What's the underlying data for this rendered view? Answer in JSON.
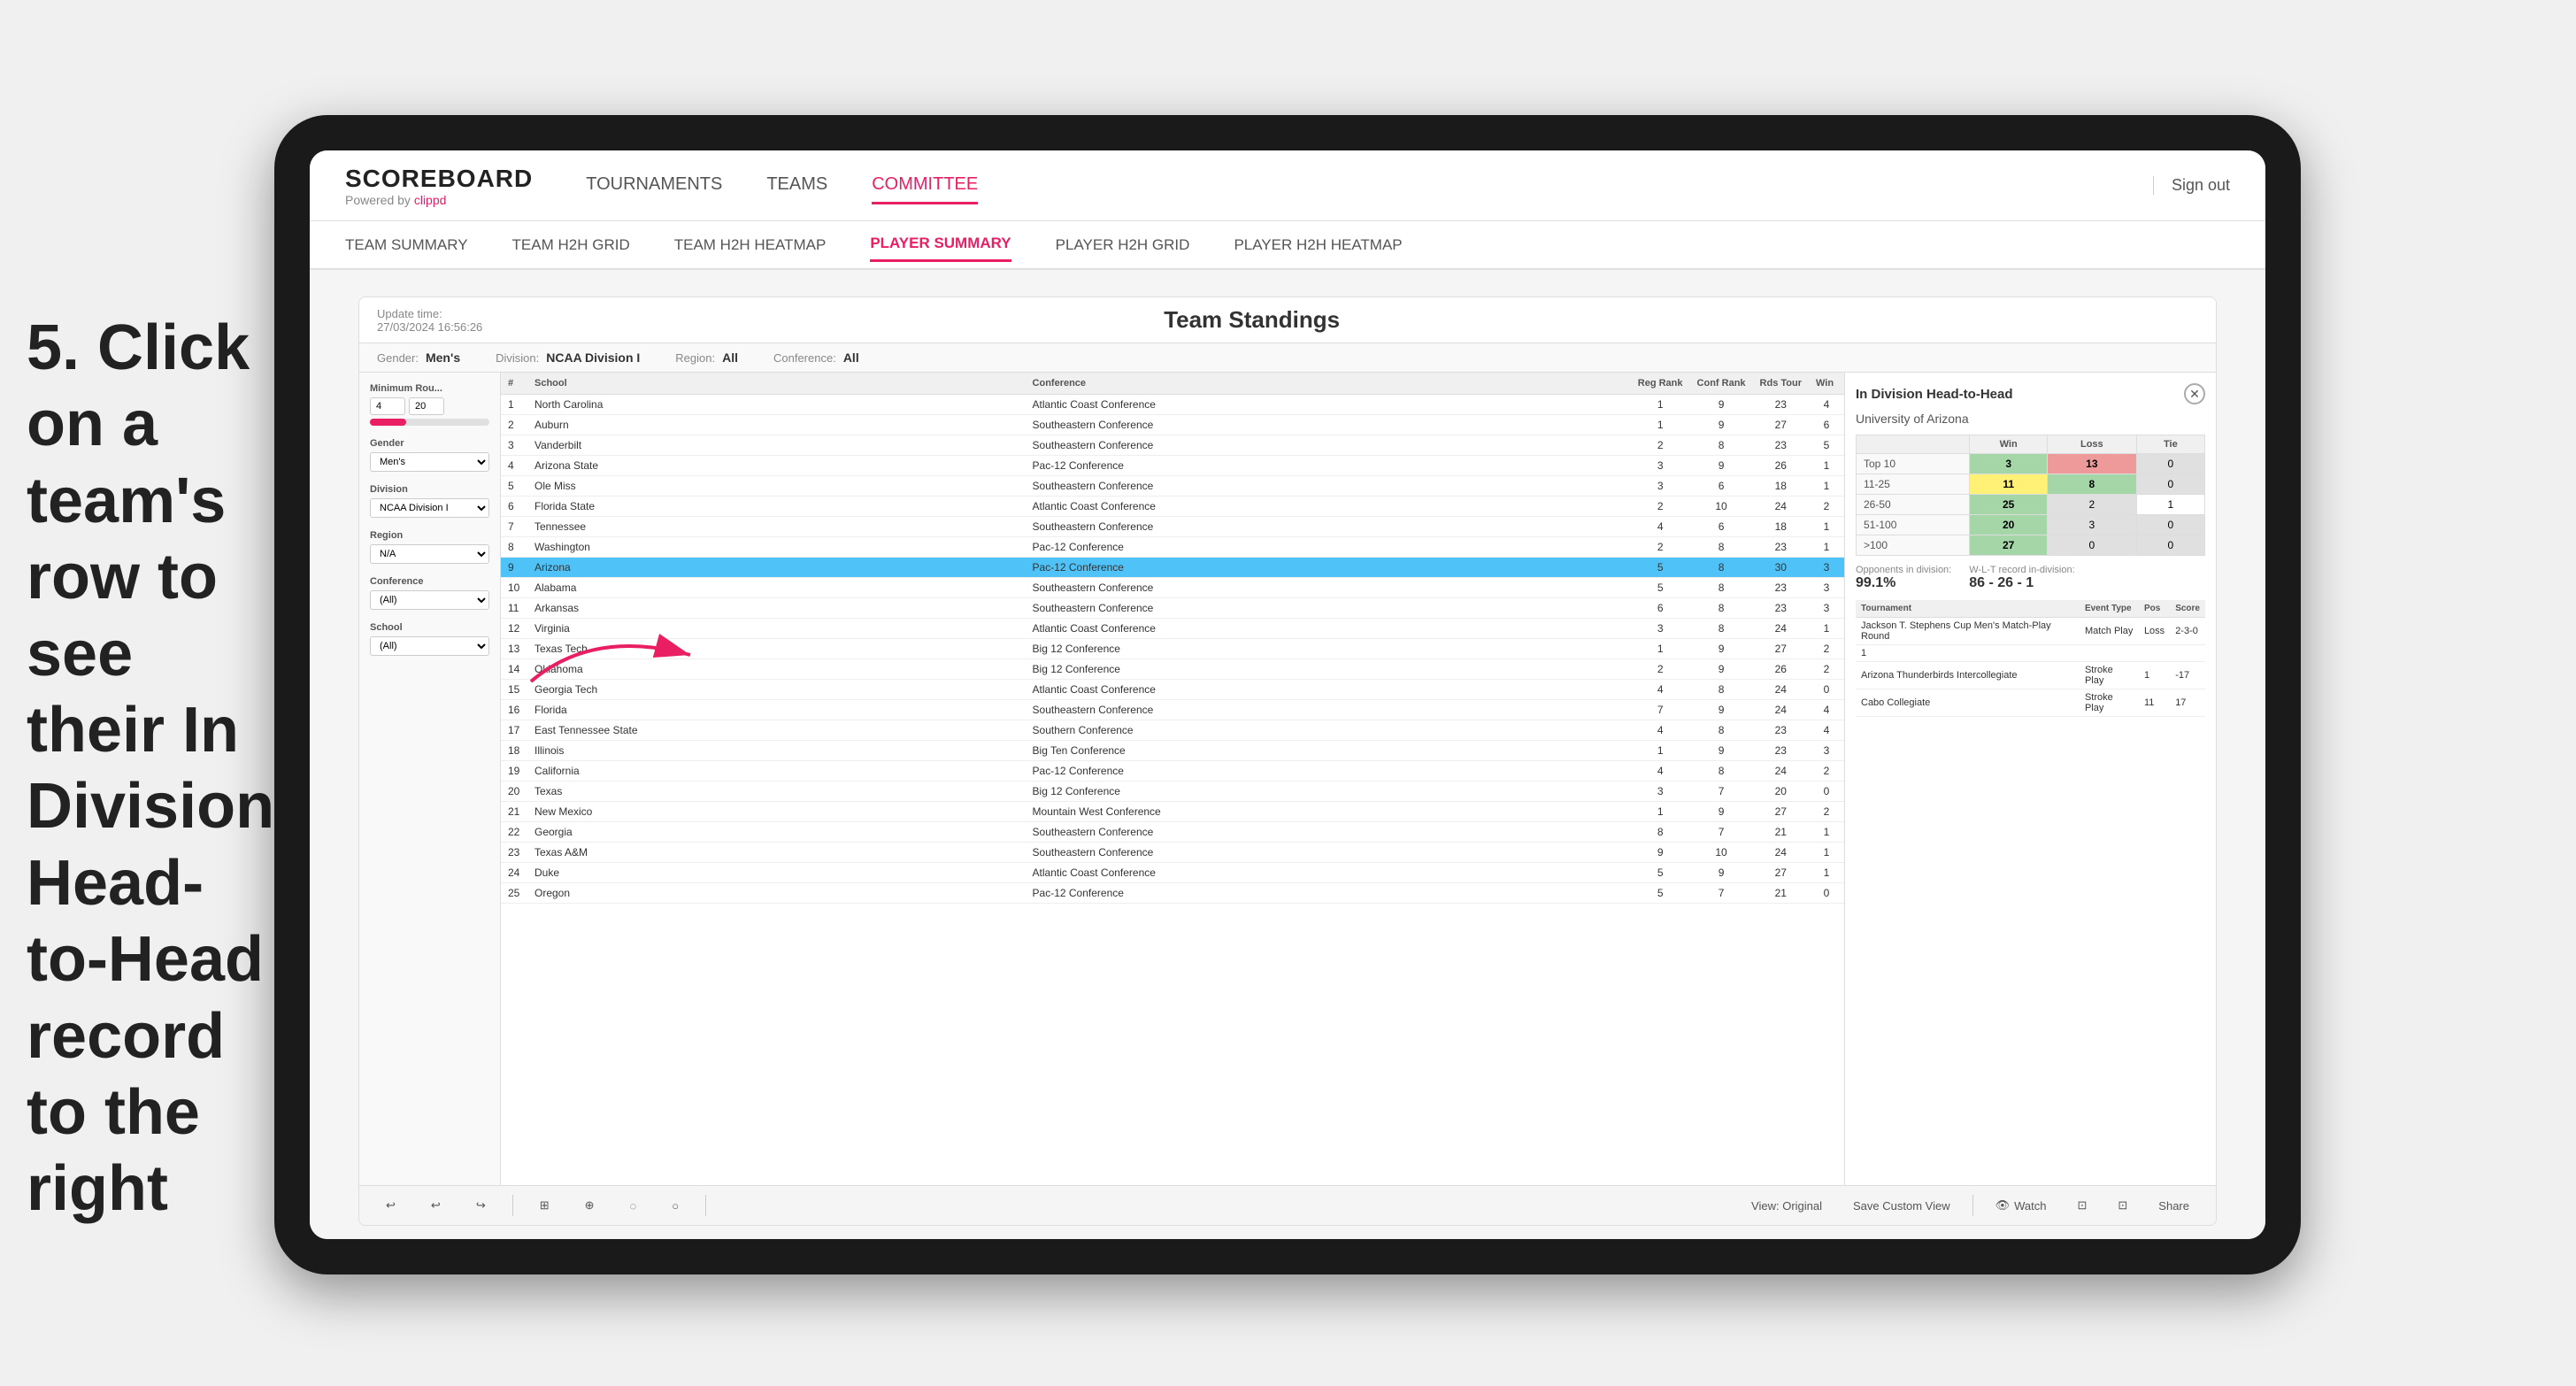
{
  "annotation": {
    "text": "5. Click on a team's row to see their In Division Head-to-Head record to the right"
  },
  "header": {
    "logo": "SCOREBOARD",
    "logo_sub": "Powered by clippd",
    "nav_items": [
      "TOURNAMENTS",
      "TEAMS",
      "COMMITTEE"
    ],
    "active_nav": "COMMITTEE",
    "sign_out": "Sign out"
  },
  "sub_nav": {
    "items": [
      "TEAM SUMMARY",
      "TEAM H2H GRID",
      "TEAM H2H HEATMAP",
      "PLAYER SUMMARY",
      "PLAYER H2H GRID",
      "PLAYER H2H HEATMAP"
    ],
    "active": "PLAYER SUMMARY"
  },
  "app": {
    "update_time_label": "Update time:",
    "update_time": "27/03/2024 16:56:26",
    "title": "Team Standings",
    "filters": {
      "gender_label": "Gender:",
      "gender_value": "Men's",
      "division_label": "Division:",
      "division_value": "NCAA Division I",
      "region_label": "Region:",
      "region_value": "All",
      "conference_label": "Conference:",
      "conference_value": "All"
    },
    "sidebar": {
      "min_rounds_label": "Minimum Rou...",
      "min_rounds_value": "4",
      "min_rounds_max": "20",
      "gender_label": "Gender",
      "gender_options": [
        "Men's"
      ],
      "division_label": "Division",
      "division_options": [
        "NCAA Division I"
      ],
      "region_label": "Region",
      "region_options": [
        "N/A"
      ],
      "conference_label": "Conference",
      "conference_options": [
        "(All)"
      ],
      "school_label": "School",
      "school_options": [
        "(All)"
      ]
    },
    "table": {
      "headers": [
        "#",
        "School",
        "Conference",
        "Reg Rank",
        "Conf Rank",
        "Rds Tour",
        "Win"
      ],
      "rows": [
        {
          "rank": 1,
          "school": "North Carolina",
          "conference": "Atlantic Coast Conference",
          "reg_rank": 1,
          "conf_rank": 9,
          "rds_tour": 23,
          "win": 4
        },
        {
          "rank": 2,
          "school": "Auburn",
          "conference": "Southeastern Conference",
          "reg_rank": 1,
          "conf_rank": 9,
          "rds_tour": 27,
          "win": 6
        },
        {
          "rank": 3,
          "school": "Vanderbilt",
          "conference": "Southeastern Conference",
          "reg_rank": 2,
          "conf_rank": 8,
          "rds_tour": 23,
          "win": 5
        },
        {
          "rank": 4,
          "school": "Arizona State",
          "conference": "Pac-12 Conference",
          "reg_rank": 3,
          "conf_rank": 9,
          "rds_tour": 26,
          "win": 1
        },
        {
          "rank": 5,
          "school": "Ole Miss",
          "conference": "Southeastern Conference",
          "reg_rank": 3,
          "conf_rank": 6,
          "rds_tour": 18,
          "win": 1
        },
        {
          "rank": 6,
          "school": "Florida State",
          "conference": "Atlantic Coast Conference",
          "reg_rank": 2,
          "conf_rank": 10,
          "rds_tour": 24,
          "win": 2
        },
        {
          "rank": 7,
          "school": "Tennessee",
          "conference": "Southeastern Conference",
          "reg_rank": 4,
          "conf_rank": 6,
          "rds_tour": 18,
          "win": 1
        },
        {
          "rank": 8,
          "school": "Washington",
          "conference": "Pac-12 Conference",
          "reg_rank": 2,
          "conf_rank": 8,
          "rds_tour": 23,
          "win": 1
        },
        {
          "rank": 9,
          "school": "Arizona",
          "conference": "Pac-12 Conference",
          "reg_rank": 5,
          "conf_rank": 8,
          "rds_tour": 30,
          "win": 3,
          "highlighted": true
        },
        {
          "rank": 10,
          "school": "Alabama",
          "conference": "Southeastern Conference",
          "reg_rank": 5,
          "conf_rank": 8,
          "rds_tour": 23,
          "win": 3
        },
        {
          "rank": 11,
          "school": "Arkansas",
          "conference": "Southeastern Conference",
          "reg_rank": 6,
          "conf_rank": 8,
          "rds_tour": 23,
          "win": 3
        },
        {
          "rank": 12,
          "school": "Virginia",
          "conference": "Atlantic Coast Conference",
          "reg_rank": 3,
          "conf_rank": 8,
          "rds_tour": 24,
          "win": 1
        },
        {
          "rank": 13,
          "school": "Texas Tech",
          "conference": "Big 12 Conference",
          "reg_rank": 1,
          "conf_rank": 9,
          "rds_tour": 27,
          "win": 2
        },
        {
          "rank": 14,
          "school": "Oklahoma",
          "conference": "Big 12 Conference",
          "reg_rank": 2,
          "conf_rank": 9,
          "rds_tour": 26,
          "win": 2
        },
        {
          "rank": 15,
          "school": "Georgia Tech",
          "conference": "Atlantic Coast Conference",
          "reg_rank": 4,
          "conf_rank": 8,
          "rds_tour": 24,
          "win": 0
        },
        {
          "rank": 16,
          "school": "Florida",
          "conference": "Southeastern Conference",
          "reg_rank": 7,
          "conf_rank": 9,
          "rds_tour": 24,
          "win": 4
        },
        {
          "rank": 17,
          "school": "East Tennessee State",
          "conference": "Southern Conference",
          "reg_rank": 4,
          "conf_rank": 8,
          "rds_tour": 23,
          "win": 4
        },
        {
          "rank": 18,
          "school": "Illinois",
          "conference": "Big Ten Conference",
          "reg_rank": 1,
          "conf_rank": 9,
          "rds_tour": 23,
          "win": 3
        },
        {
          "rank": 19,
          "school": "California",
          "conference": "Pac-12 Conference",
          "reg_rank": 4,
          "conf_rank": 8,
          "rds_tour": 24,
          "win": 2
        },
        {
          "rank": 20,
          "school": "Texas",
          "conference": "Big 12 Conference",
          "reg_rank": 3,
          "conf_rank": 7,
          "rds_tour": 20,
          "win": 0
        },
        {
          "rank": 21,
          "school": "New Mexico",
          "conference": "Mountain West Conference",
          "reg_rank": 1,
          "conf_rank": 9,
          "rds_tour": 27,
          "win": 2
        },
        {
          "rank": 22,
          "school": "Georgia",
          "conference": "Southeastern Conference",
          "reg_rank": 8,
          "conf_rank": 7,
          "rds_tour": 21,
          "win": 1
        },
        {
          "rank": 23,
          "school": "Texas A&M",
          "conference": "Southeastern Conference",
          "reg_rank": 9,
          "conf_rank": 10,
          "rds_tour": 24,
          "win": 1
        },
        {
          "rank": 24,
          "school": "Duke",
          "conference": "Atlantic Coast Conference",
          "reg_rank": 5,
          "conf_rank": 9,
          "rds_tour": 27,
          "win": 1
        },
        {
          "rank": 25,
          "school": "Oregon",
          "conference": "Pac-12 Conference",
          "reg_rank": 5,
          "conf_rank": 7,
          "rds_tour": 21,
          "win": 0
        }
      ]
    },
    "h2h_panel": {
      "title": "In Division Head-to-Head",
      "team_name": "University of Arizona",
      "table_headers": [
        "",
        "Win",
        "Loss",
        "Tie"
      ],
      "rows": [
        {
          "label": "Top 10",
          "win": 3,
          "loss": 13,
          "tie": 0,
          "win_color": "green",
          "loss_color": "red"
        },
        {
          "label": "11-25",
          "win": 11,
          "loss": 8,
          "tie": 0,
          "win_color": "yellow",
          "loss_color": "green"
        },
        {
          "label": "26-50",
          "win": 25,
          "loss": 2,
          "tie": 1,
          "win_color": "green-dark",
          "loss_color": ""
        },
        {
          "label": "51-100",
          "win": 20,
          "loss": 3,
          "tie": 0,
          "win_color": "green-dark",
          "loss_color": ""
        },
        {
          "label": ">100",
          "win": 27,
          "loss": 0,
          "tie": 0,
          "win_color": "green-dark",
          "loss_color": "zero"
        }
      ],
      "opponents_label": "Opponents in division:",
      "opponents_value": "99.1%",
      "wlt_label": "W-L-T record in-division:",
      "wlt_value": "86 - 26 - 1",
      "tournament_headers": [
        "Tournament",
        "Event Type",
        "Pos",
        "Score"
      ],
      "tournament_rows": [
        {
          "tournament": "Jackson T. Stephens Cup Men's Match-Play Round",
          "event_type": "Match Play",
          "pos": "Loss",
          "score": "2-3-0"
        },
        {
          "tournament": "1",
          "event_type": "",
          "pos": "",
          "score": ""
        },
        {
          "tournament": "Arizona Thunderbirds Intercollegiate",
          "event_type": "Stroke Play",
          "pos": "1",
          "score": "-17"
        },
        {
          "tournament": "Cabo Collegiate",
          "event_type": "Stroke Play",
          "pos": "11",
          "score": "17"
        }
      ]
    },
    "toolbar": {
      "buttons": [
        "↩",
        "↩",
        "↪",
        "⊞",
        "⊕",
        "◌",
        "○"
      ],
      "view_original": "View: Original",
      "save_custom": "Save Custom View",
      "watch": "Watch",
      "icons_right": [
        "👁",
        "⊡",
        "⊡",
        "Share"
      ]
    }
  }
}
